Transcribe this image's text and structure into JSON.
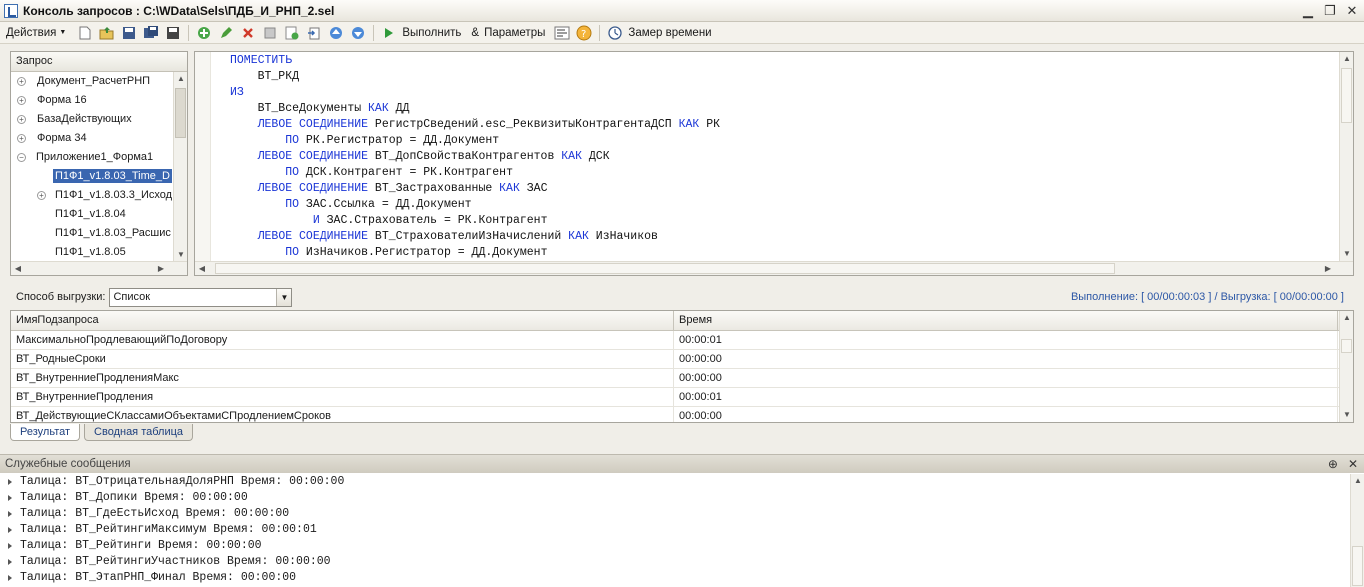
{
  "window": {
    "title": "Консоль запросов : C:\\WData\\Sels\\ПДБ_И_РНП_2.sel",
    "minimize_glyph": "▁",
    "restore_glyph": "❐",
    "close_glyph": "✕"
  },
  "toolbar": {
    "actions_label": "Действия",
    "run_label": "Выполнить",
    "params_label": "Параметры",
    "timing_label": "Замер времени",
    "params_glyph": "&"
  },
  "tree": {
    "header": "Запрос",
    "items": [
      {
        "label": "Документ_РасчетРНП",
        "toggle": "+"
      },
      {
        "label": "Форма 16",
        "toggle": "+"
      },
      {
        "label": "БазаДействующих",
        "toggle": "+"
      },
      {
        "label": "Форма 34",
        "toggle": "+"
      },
      {
        "label": "Приложение1_Форма1",
        "toggle": "−"
      },
      {
        "label": "П1Ф1_v1.8.03_Time_D",
        "selected": true
      },
      {
        "label": "П1Ф1_v1.8.03.3_Исход",
        "toggle": "+"
      },
      {
        "label": "П1Ф1_v1.8.04"
      },
      {
        "label": "П1Ф1_v1.8.03_Расшис"
      },
      {
        "label": "П1Ф1_v1.8.05"
      }
    ]
  },
  "editor": {
    "lines": [
      [
        {
          "k": 1,
          "t": "ПОМЕСТИТЬ"
        }
      ],
      [
        {
          "k": 0,
          "t": "    ВТ_РКД"
        }
      ],
      [
        {
          "k": 1,
          "t": "ИЗ"
        }
      ],
      [
        {
          "k": 0,
          "t": "    ВТ_ВсеДокументы "
        },
        {
          "k": 1,
          "t": "КАК"
        },
        {
          "k": 0,
          "t": " ДД"
        }
      ],
      [
        {
          "k": 0,
          "t": "    "
        },
        {
          "k": 1,
          "t": "ЛЕВОЕ СОЕДИНЕНИЕ"
        },
        {
          "k": 0,
          "t": " РегистрСведений.esc_РеквизитыКонтрагентаДСП "
        },
        {
          "k": 1,
          "t": "КАК"
        },
        {
          "k": 0,
          "t": " РК"
        }
      ],
      [
        {
          "k": 0,
          "t": "        "
        },
        {
          "k": 1,
          "t": "ПО"
        },
        {
          "k": 0,
          "t": " РК.Регистратор = ДД.Документ"
        }
      ],
      [
        {
          "k": 0,
          "t": "    "
        },
        {
          "k": 1,
          "t": "ЛЕВОЕ СОЕДИНЕНИЕ"
        },
        {
          "k": 0,
          "t": " ВТ_ДопСвойстваКонтрагентов "
        },
        {
          "k": 1,
          "t": "КАК"
        },
        {
          "k": 0,
          "t": " ДСК"
        }
      ],
      [
        {
          "k": 0,
          "t": "        "
        },
        {
          "k": 1,
          "t": "ПО"
        },
        {
          "k": 0,
          "t": " ДСК.Контрагент = РК.Контрагент"
        }
      ],
      [
        {
          "k": 0,
          "t": "    "
        },
        {
          "k": 1,
          "t": "ЛЕВОЕ СОЕДИНЕНИЕ"
        },
        {
          "k": 0,
          "t": " ВТ_Застрахованные "
        },
        {
          "k": 1,
          "t": "КАК"
        },
        {
          "k": 0,
          "t": " ЗАС"
        }
      ],
      [
        {
          "k": 0,
          "t": "        "
        },
        {
          "k": 1,
          "t": "ПО"
        },
        {
          "k": 0,
          "t": " ЗАС.Ссылка = ДД.Документ"
        }
      ],
      [
        {
          "k": 0,
          "t": "            "
        },
        {
          "k": 1,
          "t": "И"
        },
        {
          "k": 0,
          "t": " ЗАС.Страхователь = РК.Контрагент"
        }
      ],
      [
        {
          "k": 0,
          "t": "    "
        },
        {
          "k": 1,
          "t": "ЛЕВОЕ СОЕДИНЕНИЕ"
        },
        {
          "k": 0,
          "t": " ВТ_СтрахователиИзНачислений "
        },
        {
          "k": 1,
          "t": "КАК"
        },
        {
          "k": 0,
          "t": " ИзНачиков"
        }
      ],
      [
        {
          "k": 0,
          "t": "        "
        },
        {
          "k": 1,
          "t": "ПО"
        },
        {
          "k": 0,
          "t": " ИзНачиков.Регистратор = ДД.Документ"
        }
      ]
    ]
  },
  "export": {
    "label": "Способ выгрузки:",
    "value": "Список",
    "exec_info": "Выполнение: [ 00/00:00:03 ] / Выгрузка: [ 00/00:00:00 ]"
  },
  "grid": {
    "columns": [
      "ИмяПодзапроса",
      "Время"
    ],
    "rows": [
      [
        "МаксимальноПродлевающийПоДоговору",
        "00:00:01"
      ],
      [
        "ВТ_РодныеСроки",
        "00:00:00"
      ],
      [
        "ВТ_ВнутренниеПродленияМакс",
        "00:00:00"
      ],
      [
        "ВТ_ВнутренниеПродления",
        "00:00:01"
      ],
      [
        "ВТ_ДействующиеСКлассамиОбъектамиСПродлениемСроков",
        "00:00:00"
      ]
    ]
  },
  "tabs": [
    "Результат",
    "Сводная таблица"
  ],
  "messages": {
    "title": "Служебные сообщения",
    "items": [
      "Талица: ВТ_ОтрицательнаяДоляРНП Время: 00:00:00",
      "Талица: ВТ_Допики Время: 00:00:00",
      "Талица: ВТ_ГдеЕстьИсход Время: 00:00:00",
      "Талица: ВТ_РейтингиМаксимум Время: 00:00:01",
      "Талица: ВТ_Рейтинги Время: 00:00:00",
      "Талица: ВТ_РейтингиУчастников Время: 00:00:00",
      "Талица: ВТ_ЭтапРНП_Финал Время: 00:00:00"
    ]
  },
  "colors": {
    "keyword": "#1a35d6",
    "selection": "#3a66b0",
    "info_text": "#2c57a6"
  }
}
